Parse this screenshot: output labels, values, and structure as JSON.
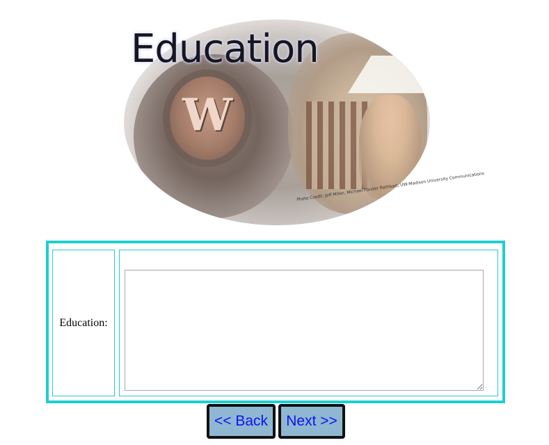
{
  "banner": {
    "title": "Education",
    "seal_letter": "W",
    "photo_credit": "Photo Credit: Jeff Miller, Michael Forster Rothbart, UW-Madison University Communications"
  },
  "form": {
    "education_label": "Education:",
    "education_value": ""
  },
  "navigation": {
    "back_label": "<< Back",
    "next_label": "Next >>"
  },
  "colors": {
    "table_border": "#1ecfcf",
    "button_background": "#8fb7d2",
    "button_text": "#1111ee"
  }
}
